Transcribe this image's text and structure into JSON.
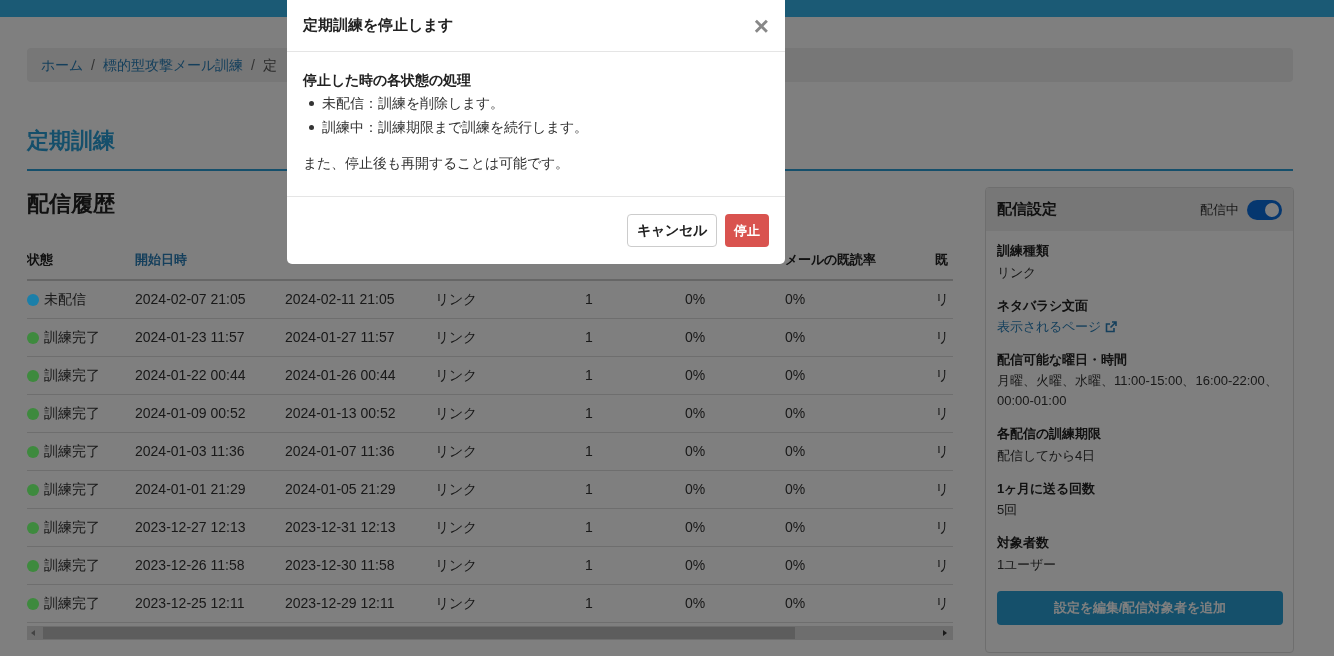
{
  "breadcrumb": {
    "separator": "/",
    "items": [
      {
        "label": "ホーム",
        "link": true
      },
      {
        "label": "標的型攻撃メール訓練",
        "link": true
      },
      {
        "label": "定",
        "link": false
      }
    ]
  },
  "page_title": "定期訓練",
  "section_title": "配信履歴",
  "table": {
    "columns": [
      {
        "label": "状態",
        "sortable": false
      },
      {
        "label": "開始日時",
        "sortable": true
      },
      {},
      {},
      {},
      {},
      {
        "label": "メールの既読率",
        "sortable": false
      },
      {
        "label": "既",
        "sortable": false
      }
    ],
    "rows": [
      {
        "color": "#1b7fa9",
        "cells": [
          "未配信",
          "2024-02-07 21:05",
          "2024-02-11 21:05",
          "リンク",
          "1",
          "0%",
          "0%",
          "リ"
        ]
      },
      {
        "color": "#3e8a3e",
        "cells": [
          "訓練完了",
          "2024-01-23 11:57",
          "2024-01-27 11:57",
          "リンク",
          "1",
          "0%",
          "0%",
          "リ"
        ]
      },
      {
        "color": "#3e8a3e",
        "cells": [
          "訓練完了",
          "2024-01-22 00:44",
          "2024-01-26 00:44",
          "リンク",
          "1",
          "0%",
          "0%",
          "リ"
        ]
      },
      {
        "color": "#3e8a3e",
        "cells": [
          "訓練完了",
          "2024-01-09 00:52",
          "2024-01-13 00:52",
          "リンク",
          "1",
          "0%",
          "0%",
          "リ"
        ]
      },
      {
        "color": "#3e8a3e",
        "cells": [
          "訓練完了",
          "2024-01-03 11:36",
          "2024-01-07 11:36",
          "リンク",
          "1",
          "0%",
          "0%",
          "リ"
        ]
      },
      {
        "color": "#3e8a3e",
        "cells": [
          "訓練完了",
          "2024-01-01 21:29",
          "2024-01-05 21:29",
          "リンク",
          "1",
          "0%",
          "0%",
          "リ"
        ]
      },
      {
        "color": "#3e8a3e",
        "cells": [
          "訓練完了",
          "2023-12-27 12:13",
          "2023-12-31 12:13",
          "リンク",
          "1",
          "0%",
          "0%",
          "リ"
        ]
      },
      {
        "color": "#3e8a3e",
        "cells": [
          "訓練完了",
          "2023-12-26 11:58",
          "2023-12-30 11:58",
          "リンク",
          "1",
          "0%",
          "0%",
          "リ"
        ]
      },
      {
        "color": "#3e8a3e",
        "cells": [
          "訓練完了",
          "2023-12-25 12:11",
          "2023-12-29 12:11",
          "リンク",
          "1",
          "0%",
          "0%",
          "リ"
        ]
      }
    ]
  },
  "settings": {
    "title": "配信設定",
    "toggle": {
      "label": "配信中",
      "on": true
    },
    "fields": [
      {
        "label": "訓練種類",
        "value": "リンク",
        "kind": "text"
      },
      {
        "label": "ネタバラシ文面",
        "value": "表示されるページ",
        "kind": "link"
      },
      {
        "label": "配信可能な曜日・時間",
        "value": "月曜、火曜、水曜、11:00-15:00、16:00-22:00、00:00-01:00",
        "kind": "text"
      },
      {
        "label": "各配信の訓練期限",
        "value": "配信してから4日",
        "kind": "text"
      },
      {
        "label": "1ヶ月に送る回数",
        "value": "5回",
        "kind": "text"
      },
      {
        "label": "対象者数",
        "value": "1ユーザー",
        "kind": "text"
      }
    ],
    "button": "設定を編集/配信対象者を追加"
  },
  "modal": {
    "title": "定期訓練を停止します",
    "close": "×",
    "heading": "停止した時の各状態の処理",
    "bullets": [
      "未配信：訓練を削除します。",
      "訓練中：訓練期限まで訓練を続行します。"
    ],
    "note": "また、停止後も再開することは可能です。",
    "cancel": "キャンセル",
    "confirm": "停止"
  }
}
